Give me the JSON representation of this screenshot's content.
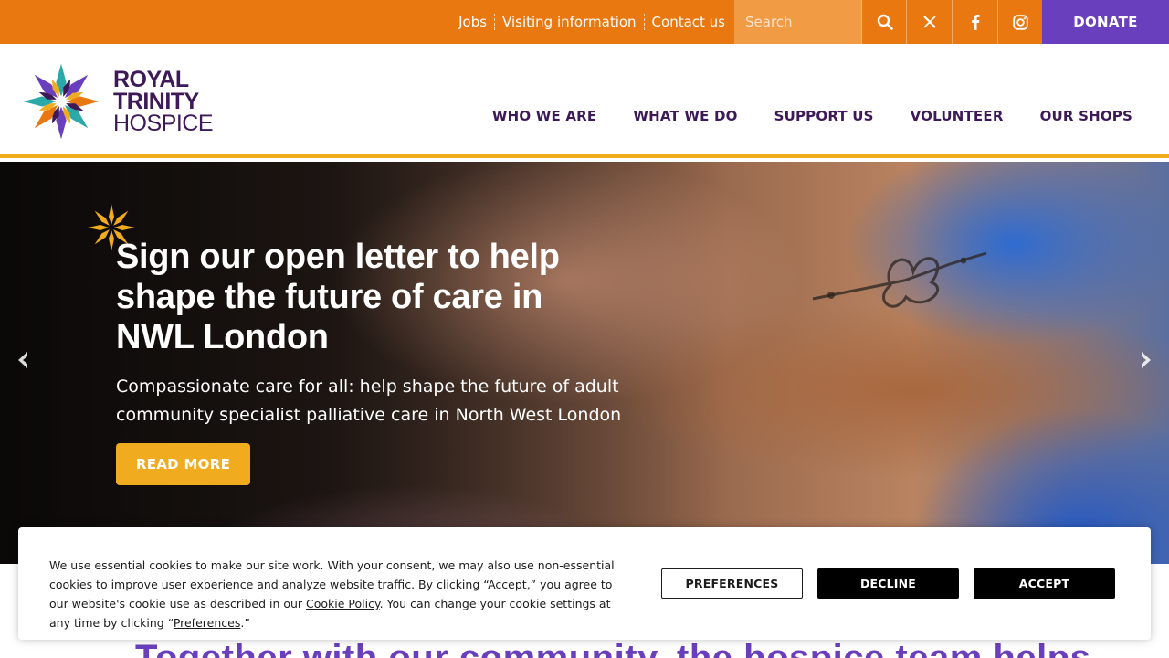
{
  "topbar": {
    "links": [
      "Jobs",
      "Visiting information",
      "Contact us"
    ],
    "search_placeholder": "Search",
    "icons": [
      "search-icon",
      "x-twitter-icon",
      "facebook-icon",
      "instagram-icon"
    ],
    "donate_label": "DONATE"
  },
  "header": {
    "logo": {
      "line1": "ROYAL",
      "line2": "TRINITY",
      "line3": "HOSPICE"
    },
    "nav": [
      "WHO WE ARE",
      "WHAT WE DO",
      "SUPPORT US",
      "VOLUNTEER",
      "OUR SHOPS"
    ]
  },
  "hero": {
    "title": "Sign our open letter to help shape the future of care in NWL London",
    "subtitle": "Compassionate care for all: help shape the future of adult community specialist palliative care in North West London",
    "cta_label": "READ MORE",
    "prev_icon": "chevron-left-icon",
    "next_icon": "chevron-right-icon"
  },
  "section": {
    "heading_partial": "Together with our community, the hospice team helps"
  },
  "cookie": {
    "text_before_link": "We use essential cookies to make our site work. With your consent, we may also use non-essential cookies to improve user experience and analyze website traffic. By clicking “Accept,” you agree to our website's cookie use as described in our ",
    "policy_link": "Cookie Policy",
    "text_middle": ". You can change your cookie settings at any time by clicking “",
    "preferences_link": "Preferences",
    "text_end": ".”",
    "buttons": {
      "preferences": "PREFERENCES",
      "decline": "DECLINE",
      "accept": "ACCEPT"
    }
  },
  "colors": {
    "topbar": "#e8780f",
    "donate": "#6a3fbd",
    "nav_text": "#3d1a57",
    "accent_gold": "#f0ab1e",
    "heading_purple": "#6a3fbd"
  }
}
